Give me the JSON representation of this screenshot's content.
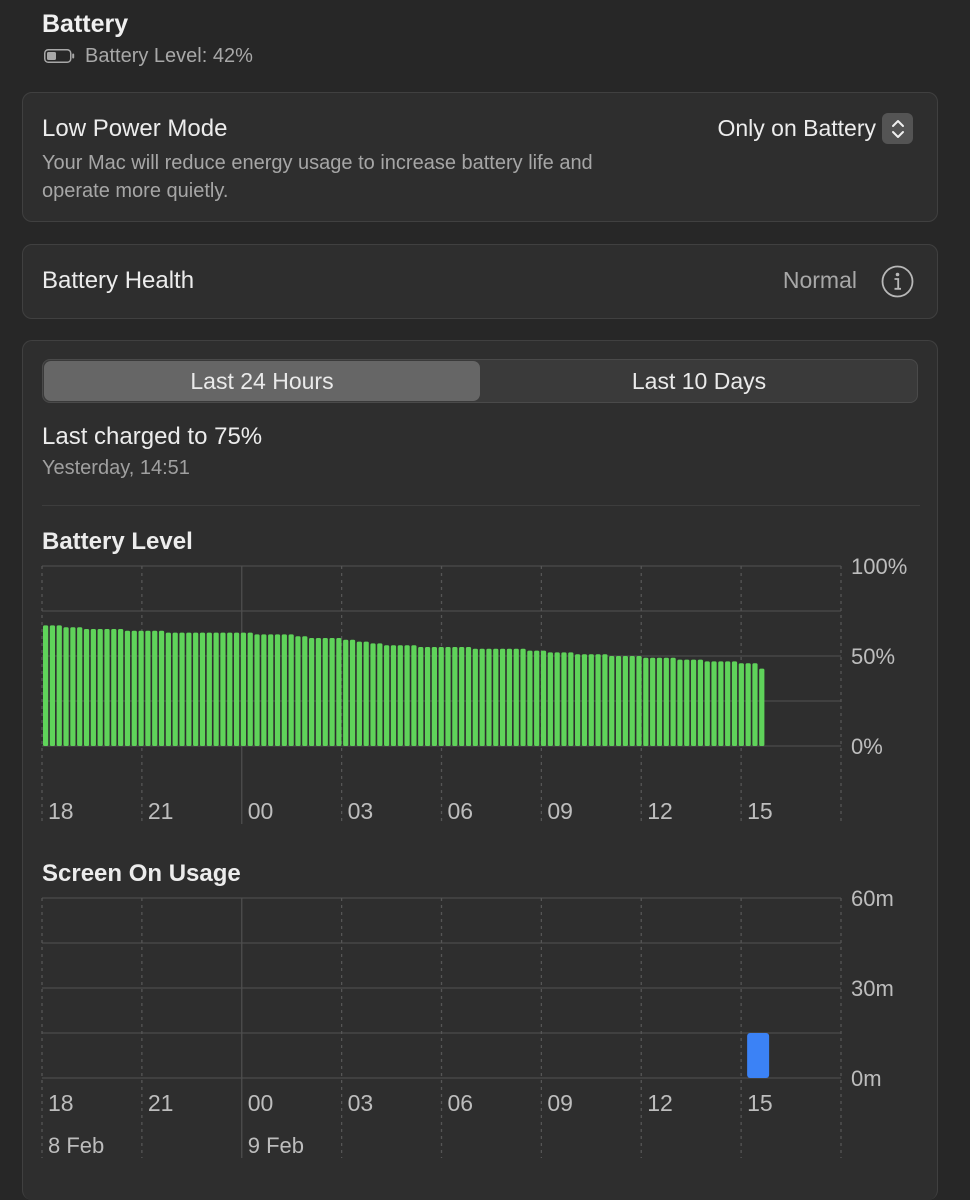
{
  "header": {
    "title": "Battery",
    "battery_level_text": "Battery Level: 42%",
    "battery_level_fraction": 0.42
  },
  "low_power": {
    "title": "Low Power Mode",
    "description": "Your Mac will reduce energy usage to increase battery life and operate more quietly.",
    "value": "Only on Battery"
  },
  "health": {
    "label": "Battery Health",
    "value": "Normal"
  },
  "tabs": [
    "Last 24 Hours",
    "Last 10 Days"
  ],
  "active_tab": 0,
  "last_charged": {
    "title": "Last charged to 75%",
    "time": "Yesterday, 14:51"
  },
  "colors": {
    "battery_bar": "#5fd35a",
    "usage_bar": "#3b82f6",
    "background": "#272727",
    "card": "#2e2e2e"
  },
  "chart_data": [
    {
      "type": "bar",
      "title": "Battery Level",
      "ylabels": [
        "100%",
        "50%",
        "0%"
      ],
      "ylim": [
        0,
        100
      ],
      "unit": "%",
      "x_tick_labels": [
        "18",
        "21",
        "00",
        "03",
        "06",
        "09",
        "12",
        "15"
      ],
      "values": [
        67,
        67,
        67,
        66,
        66,
        66,
        65,
        65,
        65,
        65,
        65,
        65,
        64,
        64,
        64,
        64,
        64,
        64,
        63,
        63,
        63,
        63,
        63,
        63,
        63,
        63,
        63,
        63,
        63,
        63,
        63,
        62,
        62,
        62,
        62,
        62,
        62,
        61,
        61,
        60,
        60,
        60,
        60,
        60,
        59,
        59,
        58,
        58,
        57,
        57,
        56,
        56,
        56,
        56,
        56,
        55,
        55,
        55,
        55,
        55,
        55,
        55,
        55,
        54,
        54,
        54,
        54,
        54,
        54,
        54,
        54,
        53,
        53,
        53,
        52,
        52,
        52,
        52,
        51,
        51,
        51,
        51,
        51,
        50,
        50,
        50,
        50,
        50,
        49,
        49,
        49,
        49,
        49,
        48,
        48,
        48,
        48,
        47,
        47,
        47,
        47,
        47,
        46,
        46,
        46,
        43
      ]
    },
    {
      "type": "bar",
      "title": "Screen On Usage",
      "ylabels": [
        "60m",
        "30m",
        "0m"
      ],
      "ylim": [
        0,
        60
      ],
      "unit": "min",
      "x_tick_labels": [
        "18",
        "21",
        "00",
        "03",
        "06",
        "09",
        "12",
        "15"
      ],
      "date_labels": [
        "8 Feb",
        "9 Feb"
      ],
      "bars": [
        {
          "x_hour": "15",
          "minutes": 15
        }
      ]
    }
  ]
}
